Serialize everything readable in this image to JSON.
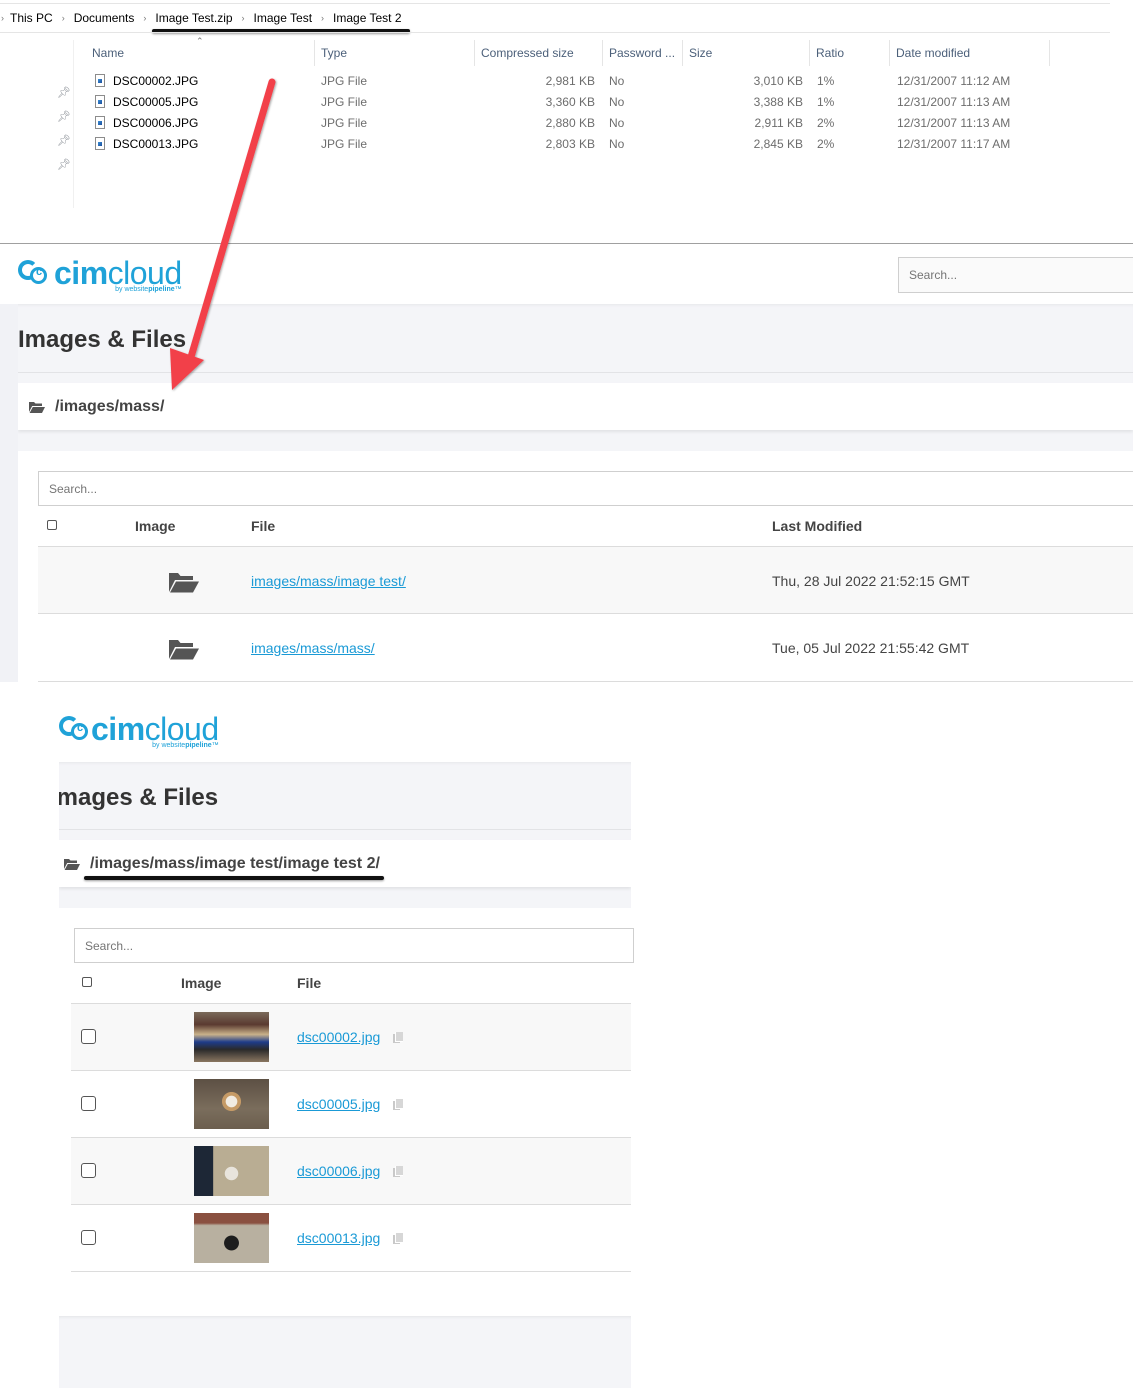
{
  "explorer": {
    "breadcrumb": [
      "This PC",
      "Documents",
      "Image Test.zip",
      "Image Test",
      "Image Test 2"
    ],
    "columns": [
      "Name",
      "Type",
      "Compressed size",
      "Password ...",
      "Size",
      "Ratio",
      "Date modified"
    ],
    "files": [
      {
        "name": "DSC00002.JPG",
        "type": "JPG File",
        "compressed": "2,981 KB",
        "password": "No",
        "size": "3,010 KB",
        "ratio": "1%",
        "modified": "12/31/2007 11:12 AM"
      },
      {
        "name": "DSC00005.JPG",
        "type": "JPG File",
        "compressed": "3,360 KB",
        "password": "No",
        "size": "3,388 KB",
        "ratio": "1%",
        "modified": "12/31/2007 11:13 AM"
      },
      {
        "name": "DSC00006.JPG",
        "type": "JPG File",
        "compressed": "2,880 KB",
        "password": "No",
        "size": "2,911 KB",
        "ratio": "2%",
        "modified": "12/31/2007 11:13 AM"
      },
      {
        "name": "DSC00013.JPG",
        "type": "JPG File",
        "compressed": "2,803 KB",
        "password": "No",
        "size": "2,845 KB",
        "ratio": "2%",
        "modified": "12/31/2007 11:17 AM"
      }
    ]
  },
  "brand": {
    "logo_bold": "cim",
    "logo_light": "cloud",
    "logo_sub_prefix": "by website",
    "logo_sub_bold": "pipeline",
    "logo_tm": "™",
    "accent": "#1fa2d8",
    "annotation_arrow": "#f2404a"
  },
  "panel1": {
    "header_search_placeholder": "Search...",
    "title": "Images & Files",
    "path": "/images/mass/",
    "search_placeholder": "Search...",
    "columns": {
      "image": "Image",
      "file": "File",
      "last_modified": "Last Modified"
    },
    "rows": [
      {
        "file": "images/mass/image test/",
        "modified": "Thu, 28 Jul 2022 21:52:15 GMT"
      },
      {
        "file": "images/mass/mass/",
        "modified": "Tue, 05 Jul 2022 21:55:42 GMT"
      }
    ]
  },
  "panel2": {
    "title": "Images & Files",
    "path": "/images/mass/image test/image test 2/",
    "search_placeholder": "Search...",
    "columns": {
      "image": "Image",
      "file": "File"
    },
    "rows": [
      {
        "file": "dsc00002.jpg"
      },
      {
        "file": "dsc00005.jpg"
      },
      {
        "file": "dsc00006.jpg"
      },
      {
        "file": "dsc00013.jpg"
      }
    ]
  }
}
